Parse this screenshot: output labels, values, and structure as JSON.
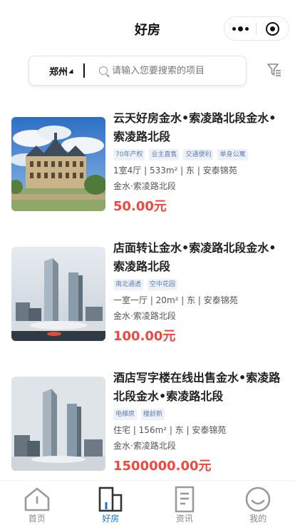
{
  "header": {
    "title": "好房"
  },
  "search": {
    "city": "郑州",
    "placeholder": "请输入您要搜索的项目"
  },
  "listings": [
    {
      "title": "云天好房金水•索凌路北段金水•索凌路北段",
      "tags": [
        "70年产权",
        "业主直售",
        "交通便利",
        "单身公寓"
      ],
      "spec": "1室4厅 | 533m² | 东 | 安泰锦苑",
      "area": "金水·索凌路北段",
      "price": "50.00元"
    },
    {
      "title": "店面转让金水•索凌路北段金水•索凌路北段",
      "tags": [
        "南北通透",
        "空中花园"
      ],
      "spec": "一室一厅 | 20m² | 东 | 安泰锦苑",
      "area": "金水·索凌路北段",
      "price": "100.00元"
    },
    {
      "title": "酒店写字楼在线出售金水•索凌路北段金水•索凌路北段",
      "tags": [
        "电梯房",
        "楼龄新"
      ],
      "spec": "住宅 | 156m² | 东 | 安泰锦苑",
      "area": "金水·索凌路北段",
      "price": "1500000.00元"
    }
  ],
  "tabbar": {
    "items": [
      {
        "label": "首页",
        "icon": "home-icon",
        "active": false
      },
      {
        "label": "好房",
        "icon": "buildings-icon",
        "active": true
      },
      {
        "label": "资讯",
        "icon": "news-icon",
        "active": false
      },
      {
        "label": "我的",
        "icon": "profile-icon",
        "active": false
      }
    ]
  },
  "colors": {
    "price": "#f0483e",
    "active_tab": "#1a73d9",
    "tag_text": "#5b7fb3",
    "tag_bg": "#eef2f8"
  }
}
